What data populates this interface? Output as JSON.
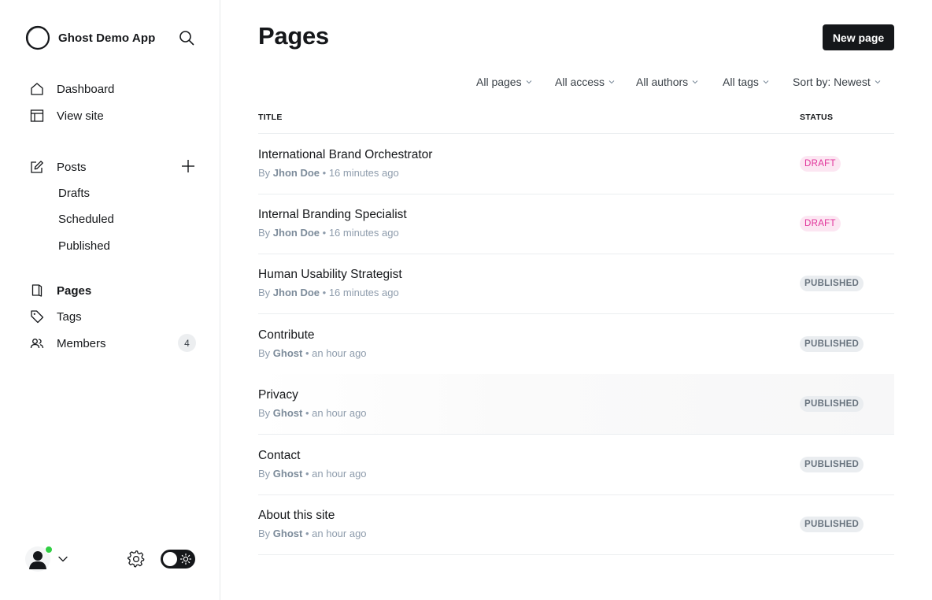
{
  "app": {
    "title": "Ghost Demo App"
  },
  "sidebar": {
    "nav": [
      {
        "label": "Dashboard",
        "icon": "home-icon"
      },
      {
        "label": "View site",
        "icon": "layout-icon"
      }
    ],
    "posts": {
      "label": "Posts",
      "icon": "edit-icon",
      "sub": [
        "Drafts",
        "Scheduled",
        "Published"
      ]
    },
    "pages": {
      "label": "Pages",
      "icon": "page-icon"
    },
    "tags": {
      "label": "Tags",
      "icon": "tag-icon"
    },
    "members": {
      "label": "Members",
      "icon": "members-icon",
      "count": "4"
    }
  },
  "header": {
    "title": "Pages",
    "new_button": "New page"
  },
  "filters": [
    "All pages",
    "All access",
    "All authors",
    "All tags",
    "Sort by: Newest"
  ],
  "table": {
    "columns": {
      "title": "TITLE",
      "status": "STATUS"
    },
    "rows": [
      {
        "title": "International Brand Orchestrator",
        "by": "By",
        "author": "Jhon Doe",
        "time": "• 16 minutes ago",
        "status": "DRAFT"
      },
      {
        "title": "Internal Branding Specialist",
        "by": "By",
        "author": "Jhon Doe",
        "time": "• 16 minutes ago",
        "status": "DRAFT"
      },
      {
        "title": "Human Usability Strategist",
        "by": "By",
        "author": "Jhon Doe",
        "time": "• 16 minutes ago",
        "status": "PUBLISHED"
      },
      {
        "title": "Contribute",
        "by": "By",
        "author": "Ghost",
        "time": "• an hour ago",
        "status": "PUBLISHED"
      },
      {
        "title": "Privacy",
        "by": "By",
        "author": "Ghost",
        "time": "• an hour ago",
        "status": "PUBLISHED"
      },
      {
        "title": "Contact",
        "by": "By",
        "author": "Ghost",
        "time": "• an hour ago",
        "status": "PUBLISHED"
      },
      {
        "title": "About this site",
        "by": "By",
        "author": "Ghost",
        "time": "• an hour ago",
        "status": "PUBLISHED"
      }
    ]
  },
  "colors": {
    "accent": "#15171a",
    "draft": "#e0339a",
    "online": "#30cf43"
  }
}
